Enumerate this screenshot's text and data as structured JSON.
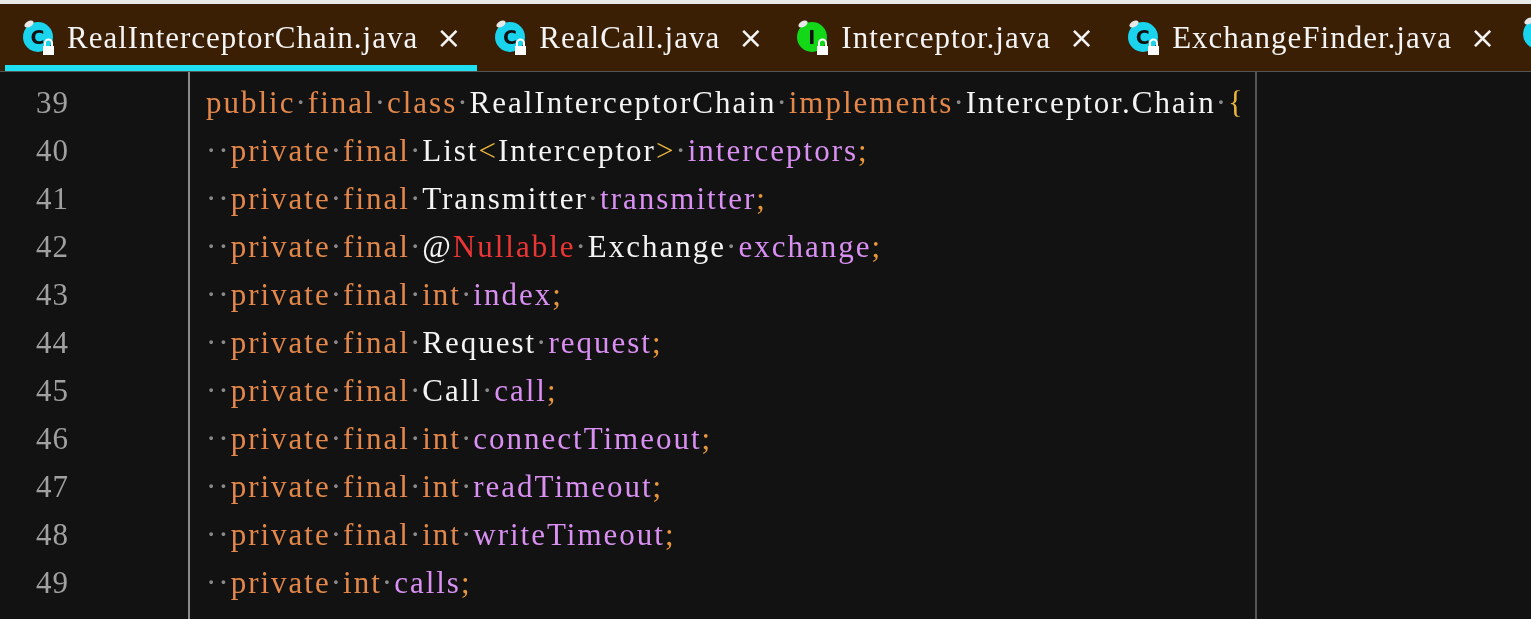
{
  "tabs": [
    {
      "label": "RealInterceptorChain.java",
      "icon": {
        "kind": "class",
        "letter": "C"
      },
      "close": "×",
      "selected": true
    },
    {
      "label": "RealCall.java",
      "icon": {
        "kind": "class",
        "letter": "C"
      },
      "close": "×",
      "selected": false
    },
    {
      "label": "Interceptor.java",
      "icon": {
        "kind": "interface",
        "letter": "I"
      },
      "close": "×",
      "selected": false
    },
    {
      "label": "ExchangeFinder.java",
      "icon": {
        "kind": "class",
        "letter": "C"
      },
      "close": "×",
      "selected": false
    },
    {
      "icon": {
        "kind": "class"
      }
    }
  ],
  "editor": {
    "lines": [
      {
        "number": "39",
        "tokens": [
          {
            "kind": "keyword",
            "text": "public"
          },
          {
            "kind": "space",
            "text": "·"
          },
          {
            "kind": "keyword",
            "text": "final"
          },
          {
            "kind": "space",
            "text": "·"
          },
          {
            "kind": "keyword",
            "text": "class"
          },
          {
            "kind": "space",
            "text": "·"
          },
          {
            "kind": "type",
            "text": "RealInterceptorChain"
          },
          {
            "kind": "space",
            "text": "·"
          },
          {
            "kind": "keyword",
            "text": "implements"
          },
          {
            "kind": "space",
            "text": "·"
          },
          {
            "kind": "type",
            "text": "Interceptor.Chain"
          },
          {
            "kind": "space",
            "text": "·"
          },
          {
            "kind": "bracket",
            "text": "{"
          }
        ]
      },
      {
        "number": "40",
        "tokens": [
          {
            "kind": "space",
            "text": "··"
          },
          {
            "kind": "keyword",
            "text": "private"
          },
          {
            "kind": "space",
            "text": "·"
          },
          {
            "kind": "keyword",
            "text": "final"
          },
          {
            "kind": "space",
            "text": "·"
          },
          {
            "kind": "type",
            "text": "List"
          },
          {
            "kind": "bracket",
            "text": "<"
          },
          {
            "kind": "type",
            "text": "Interceptor"
          },
          {
            "kind": "bracket",
            "text": ">"
          },
          {
            "kind": "space",
            "text": "·"
          },
          {
            "kind": "field",
            "text": "interceptors"
          },
          {
            "kind": "punct",
            "text": ";"
          }
        ]
      },
      {
        "number": "41",
        "tokens": [
          {
            "kind": "space",
            "text": "··"
          },
          {
            "kind": "keyword",
            "text": "private"
          },
          {
            "kind": "space",
            "text": "·"
          },
          {
            "kind": "keyword",
            "text": "final"
          },
          {
            "kind": "space",
            "text": "·"
          },
          {
            "kind": "type",
            "text": "Transmitter"
          },
          {
            "kind": "space",
            "text": "·"
          },
          {
            "kind": "field",
            "text": "transmitter"
          },
          {
            "kind": "punct",
            "text": ";"
          }
        ]
      },
      {
        "number": "42",
        "tokens": [
          {
            "kind": "space",
            "text": "··"
          },
          {
            "kind": "keyword",
            "text": "private"
          },
          {
            "kind": "space",
            "text": "·"
          },
          {
            "kind": "keyword",
            "text": "final"
          },
          {
            "kind": "space",
            "text": "·"
          },
          {
            "kind": "type",
            "text": "@"
          },
          {
            "kind": "annotation",
            "text": "Nullable"
          },
          {
            "kind": "space",
            "text": "·"
          },
          {
            "kind": "type",
            "text": "Exchange"
          },
          {
            "kind": "space",
            "text": "·"
          },
          {
            "kind": "field",
            "text": "exchange"
          },
          {
            "kind": "punct",
            "text": ";"
          }
        ]
      },
      {
        "number": "43",
        "tokens": [
          {
            "kind": "space",
            "text": "··"
          },
          {
            "kind": "keyword",
            "text": "private"
          },
          {
            "kind": "space",
            "text": "·"
          },
          {
            "kind": "keyword",
            "text": "final"
          },
          {
            "kind": "space",
            "text": "·"
          },
          {
            "kind": "keyword",
            "text": "int"
          },
          {
            "kind": "space",
            "text": "·"
          },
          {
            "kind": "field",
            "text": "index"
          },
          {
            "kind": "punct",
            "text": ";"
          }
        ]
      },
      {
        "number": "44",
        "tokens": [
          {
            "kind": "space",
            "text": "··"
          },
          {
            "kind": "keyword",
            "text": "private"
          },
          {
            "kind": "space",
            "text": "·"
          },
          {
            "kind": "keyword",
            "text": "final"
          },
          {
            "kind": "space",
            "text": "·"
          },
          {
            "kind": "type",
            "text": "Request"
          },
          {
            "kind": "space",
            "text": "·"
          },
          {
            "kind": "field",
            "text": "request"
          },
          {
            "kind": "punct",
            "text": ";"
          }
        ]
      },
      {
        "number": "45",
        "tokens": [
          {
            "kind": "space",
            "text": "··"
          },
          {
            "kind": "keyword",
            "text": "private"
          },
          {
            "kind": "space",
            "text": "·"
          },
          {
            "kind": "keyword",
            "text": "final"
          },
          {
            "kind": "space",
            "text": "·"
          },
          {
            "kind": "type",
            "text": "Call"
          },
          {
            "kind": "space",
            "text": "·"
          },
          {
            "kind": "field",
            "text": "call"
          },
          {
            "kind": "punct",
            "text": ";"
          }
        ]
      },
      {
        "number": "46",
        "tokens": [
          {
            "kind": "space",
            "text": "··"
          },
          {
            "kind": "keyword",
            "text": "private"
          },
          {
            "kind": "space",
            "text": "·"
          },
          {
            "kind": "keyword",
            "text": "final"
          },
          {
            "kind": "space",
            "text": "·"
          },
          {
            "kind": "keyword",
            "text": "int"
          },
          {
            "kind": "space",
            "text": "·"
          },
          {
            "kind": "field",
            "text": "connectTimeout"
          },
          {
            "kind": "punct",
            "text": ";"
          }
        ]
      },
      {
        "number": "47",
        "tokens": [
          {
            "kind": "space",
            "text": "··"
          },
          {
            "kind": "keyword",
            "text": "private"
          },
          {
            "kind": "space",
            "text": "·"
          },
          {
            "kind": "keyword",
            "text": "final"
          },
          {
            "kind": "space",
            "text": "·"
          },
          {
            "kind": "keyword",
            "text": "int"
          },
          {
            "kind": "space",
            "text": "·"
          },
          {
            "kind": "field",
            "text": "readTimeout"
          },
          {
            "kind": "punct",
            "text": ";"
          }
        ]
      },
      {
        "number": "48",
        "tokens": [
          {
            "kind": "space",
            "text": "··"
          },
          {
            "kind": "keyword",
            "text": "private"
          },
          {
            "kind": "space",
            "text": "·"
          },
          {
            "kind": "keyword",
            "text": "final"
          },
          {
            "kind": "space",
            "text": "·"
          },
          {
            "kind": "keyword",
            "text": "int"
          },
          {
            "kind": "space",
            "text": "·"
          },
          {
            "kind": "field",
            "text": "writeTimeout"
          },
          {
            "kind": "punct",
            "text": ";"
          }
        ]
      },
      {
        "number": "49",
        "tokens": [
          {
            "kind": "space",
            "text": "··"
          },
          {
            "kind": "keyword",
            "text": "private"
          },
          {
            "kind": "space",
            "text": "·"
          },
          {
            "kind": "keyword",
            "text": "int"
          },
          {
            "kind": "space",
            "text": "·"
          },
          {
            "kind": "field",
            "text": "calls"
          },
          {
            "kind": "punct",
            "text": ";"
          }
        ]
      }
    ]
  }
}
